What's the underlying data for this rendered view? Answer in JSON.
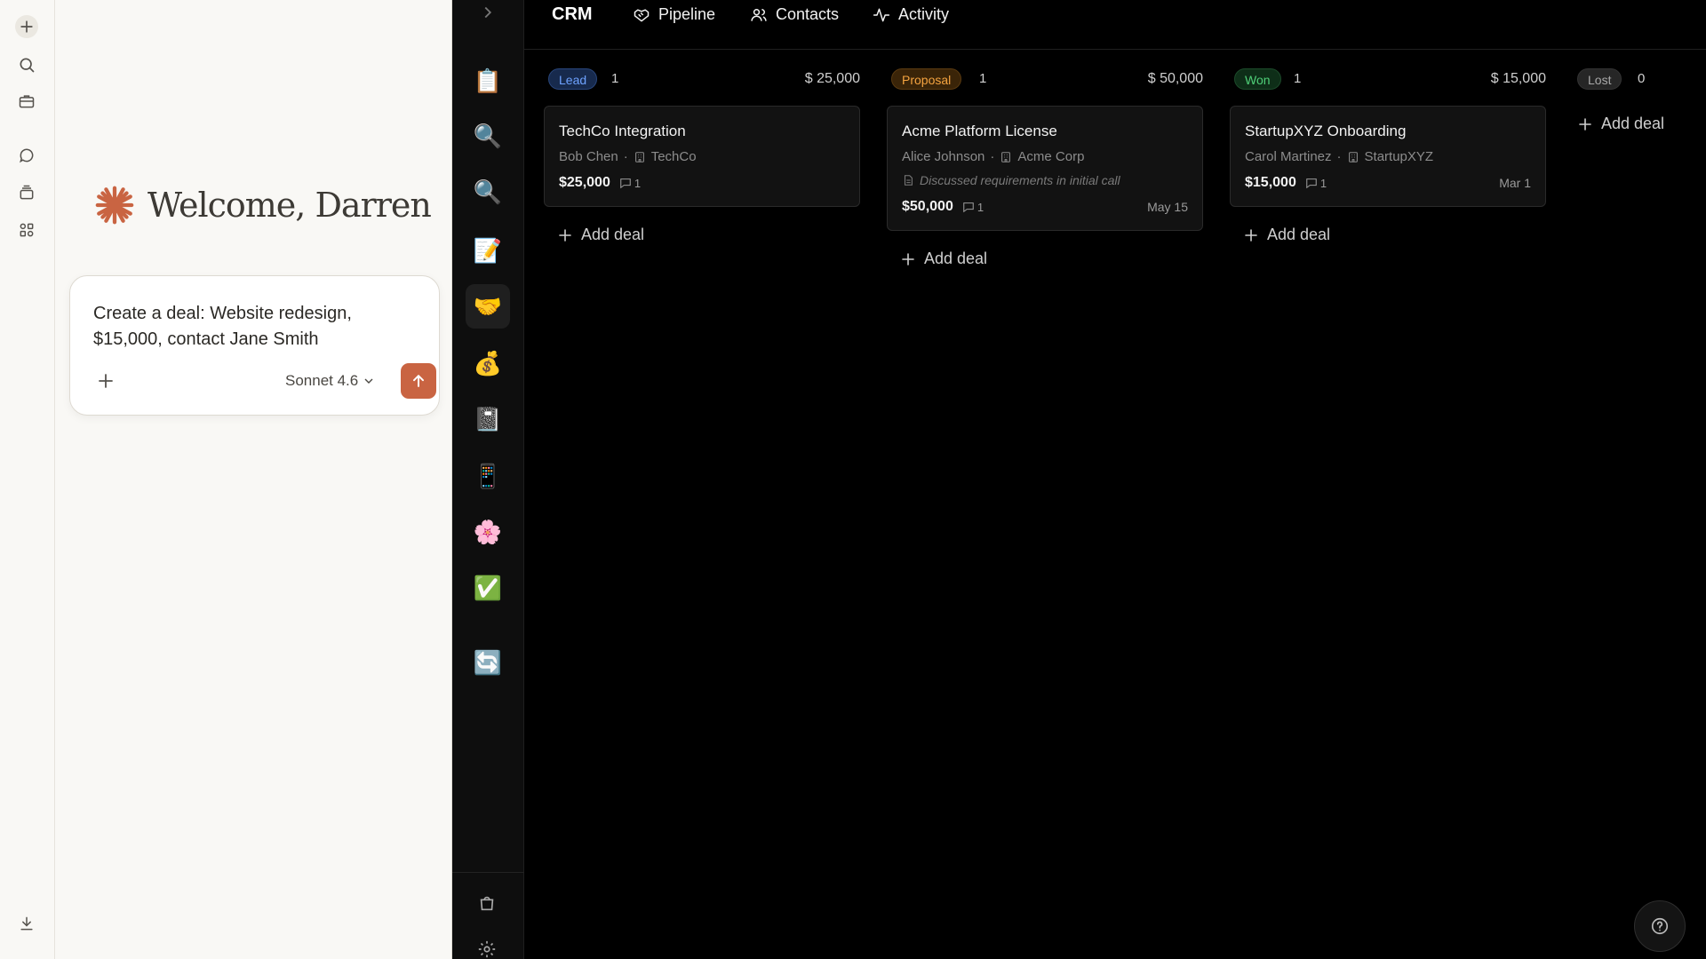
{
  "chat": {
    "welcome_text": "Welcome, Darren",
    "composer_text": "Create a deal: Website redesign, $15,000, contact Jane Smith",
    "model_label": "Sonnet 4.6",
    "brand_color": "#c96442"
  },
  "crm": {
    "brand": "CRM",
    "nav": {
      "pipeline": "Pipeline",
      "contacts": "Contacts",
      "activity": "Activity"
    },
    "dock_icons": {
      "clipboard": "📋",
      "search": "🔍",
      "search2": "🔍",
      "memo": "📝",
      "handshake": "🤝",
      "money_bag": "💰",
      "notebook": "📓",
      "phone": "📱",
      "flower": "🌸",
      "check": "✅",
      "sync": "🔄"
    },
    "columns": {
      "lead": {
        "label": "Lead",
        "count": "1",
        "total": "$ 25,000",
        "cards": [
          {
            "title": "TechCo Integration",
            "contact": "Bob Chen",
            "company": "TechCo",
            "amount": "$25,000",
            "comments": "1"
          }
        ],
        "add_label": "Add deal"
      },
      "proposal": {
        "label": "Proposal",
        "count": "1",
        "total": "$ 50,000",
        "cards": [
          {
            "title": "Acme Platform License",
            "contact": "Alice Johnson",
            "company": "Acme Corp",
            "note": "Discussed requirements in initial call",
            "amount": "$50,000",
            "comments": "1",
            "date": "May 15"
          }
        ],
        "add_label": "Add deal"
      },
      "won": {
        "label": "Won",
        "count": "1",
        "total": "$ 15,000",
        "cards": [
          {
            "title": "StartupXYZ Onboarding",
            "contact": "Carol Martinez",
            "company": "StartupXYZ",
            "amount": "$15,000",
            "comments": "1",
            "date": "Mar 1"
          }
        ],
        "add_label": "Add deal"
      },
      "lost": {
        "label": "Lost",
        "count": "0",
        "add_label": "Add deal"
      }
    },
    "colors": {
      "lead": "#6ea2ff",
      "proposal": "#f4a340",
      "won": "#4fcf78",
      "lost": "#a8a8a8"
    }
  }
}
